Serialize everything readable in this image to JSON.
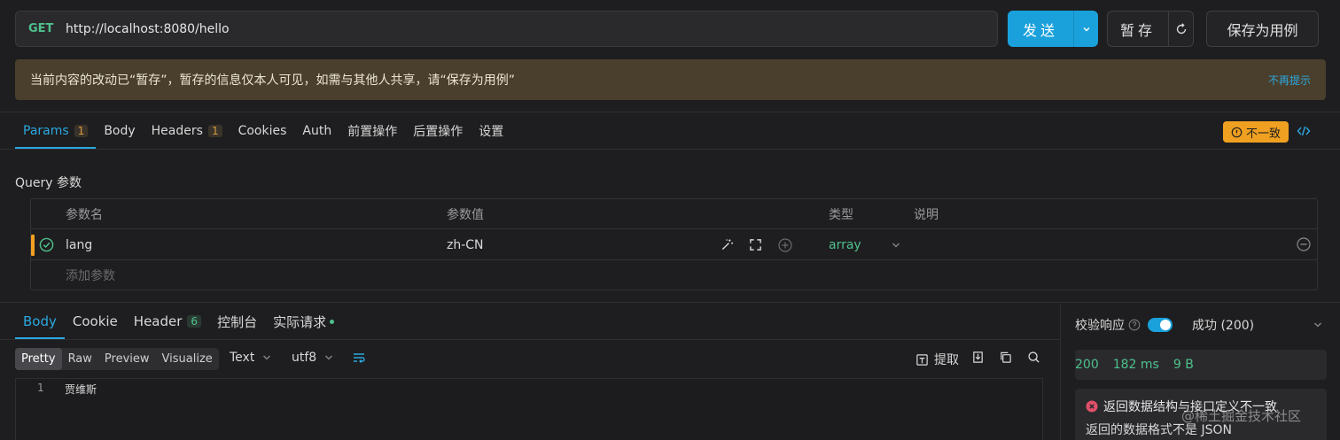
{
  "request": {
    "method": "GET",
    "url": "http://localhost:8080/hello",
    "send_label": "发送",
    "temp_save_label": "暂存",
    "save_case_label": "保存为用例"
  },
  "banner": {
    "text": "当前内容的改动已“暂存”，暂存的信息仅本人可见，如需与其他人共享，请“保存为用例”",
    "dismiss": "不再提示"
  },
  "req_tabs": [
    {
      "label": "Params",
      "count": "1"
    },
    {
      "label": "Body"
    },
    {
      "label": "Headers",
      "count": "1"
    },
    {
      "label": "Cookies"
    },
    {
      "label": "Auth"
    },
    {
      "label": "前置操作"
    },
    {
      "label": "后置操作"
    },
    {
      "label": "设置"
    }
  ],
  "status_badge": "不一致",
  "query": {
    "label": "Query 参数",
    "columns": {
      "name": "参数名",
      "value": "参数值",
      "type": "类型",
      "desc": "说明"
    },
    "rows": [
      {
        "name": "lang",
        "value": "zh-CN",
        "type": "array",
        "desc": ""
      }
    ],
    "add_placeholder": "添加参数"
  },
  "resp_tabs": [
    {
      "label": "Body"
    },
    {
      "label": "Cookie"
    },
    {
      "label": "Header",
      "count": "6"
    },
    {
      "label": "控制台"
    },
    {
      "label": "实际请求"
    }
  ],
  "format_tabs": [
    "Pretty",
    "Raw",
    "Preview",
    "Visualize"
  ],
  "format_selected": "Pretty",
  "content_type": "Text",
  "encoding": "utf8",
  "extract_label": "提取",
  "editor": {
    "line_number": "1",
    "content": "贾维斯"
  },
  "verify": {
    "label": "校验响应",
    "result": "成功 (200)",
    "toggle_on": true
  },
  "stats": {
    "status": "200",
    "time": "182 ms",
    "size": "9 B"
  },
  "warning": {
    "title": "返回数据结构与接口定义不一致",
    "detail": "返回的数据格式不是 JSON"
  },
  "watermark": "@稀土掘金技术社区",
  "colors": {
    "accent": "#1aa1dc",
    "success": "#4fc08d",
    "warning": "#f0a020",
    "error": "#e0506a"
  }
}
